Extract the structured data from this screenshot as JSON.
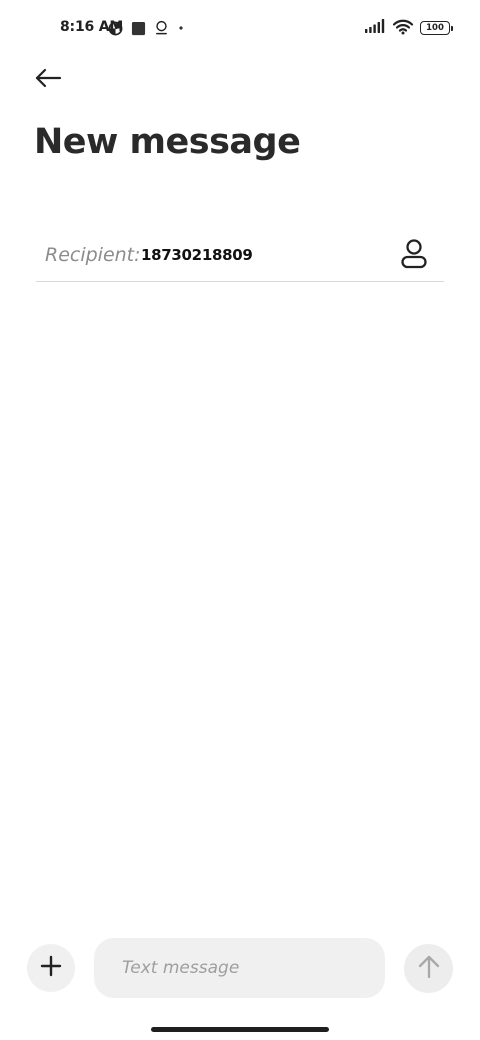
{
  "status_bar": {
    "time": "8:16 AM",
    "battery_level": "100",
    "icons_left": [
      "data-saver-icon",
      "square-notification-icon",
      "location-pin-icon",
      "dot-icon"
    ],
    "icons_right": [
      "signal-icon",
      "wifi-icon",
      "battery-icon"
    ]
  },
  "header": {
    "back_icon": "arrow-left-icon",
    "title": "New message"
  },
  "recipient": {
    "label": "Recipient:",
    "value": "18730218809",
    "contact_icon": "person-icon"
  },
  "composer": {
    "add_icon": "plus-icon",
    "placeholder": "Text message",
    "value": "",
    "send_icon": "arrow-up-icon"
  },
  "colors": {
    "background": "#ffffff",
    "text": "#222222",
    "muted": "#8c8c8c",
    "input_bg": "#f0f0f0",
    "send_disabled": "#a8a8a8"
  }
}
